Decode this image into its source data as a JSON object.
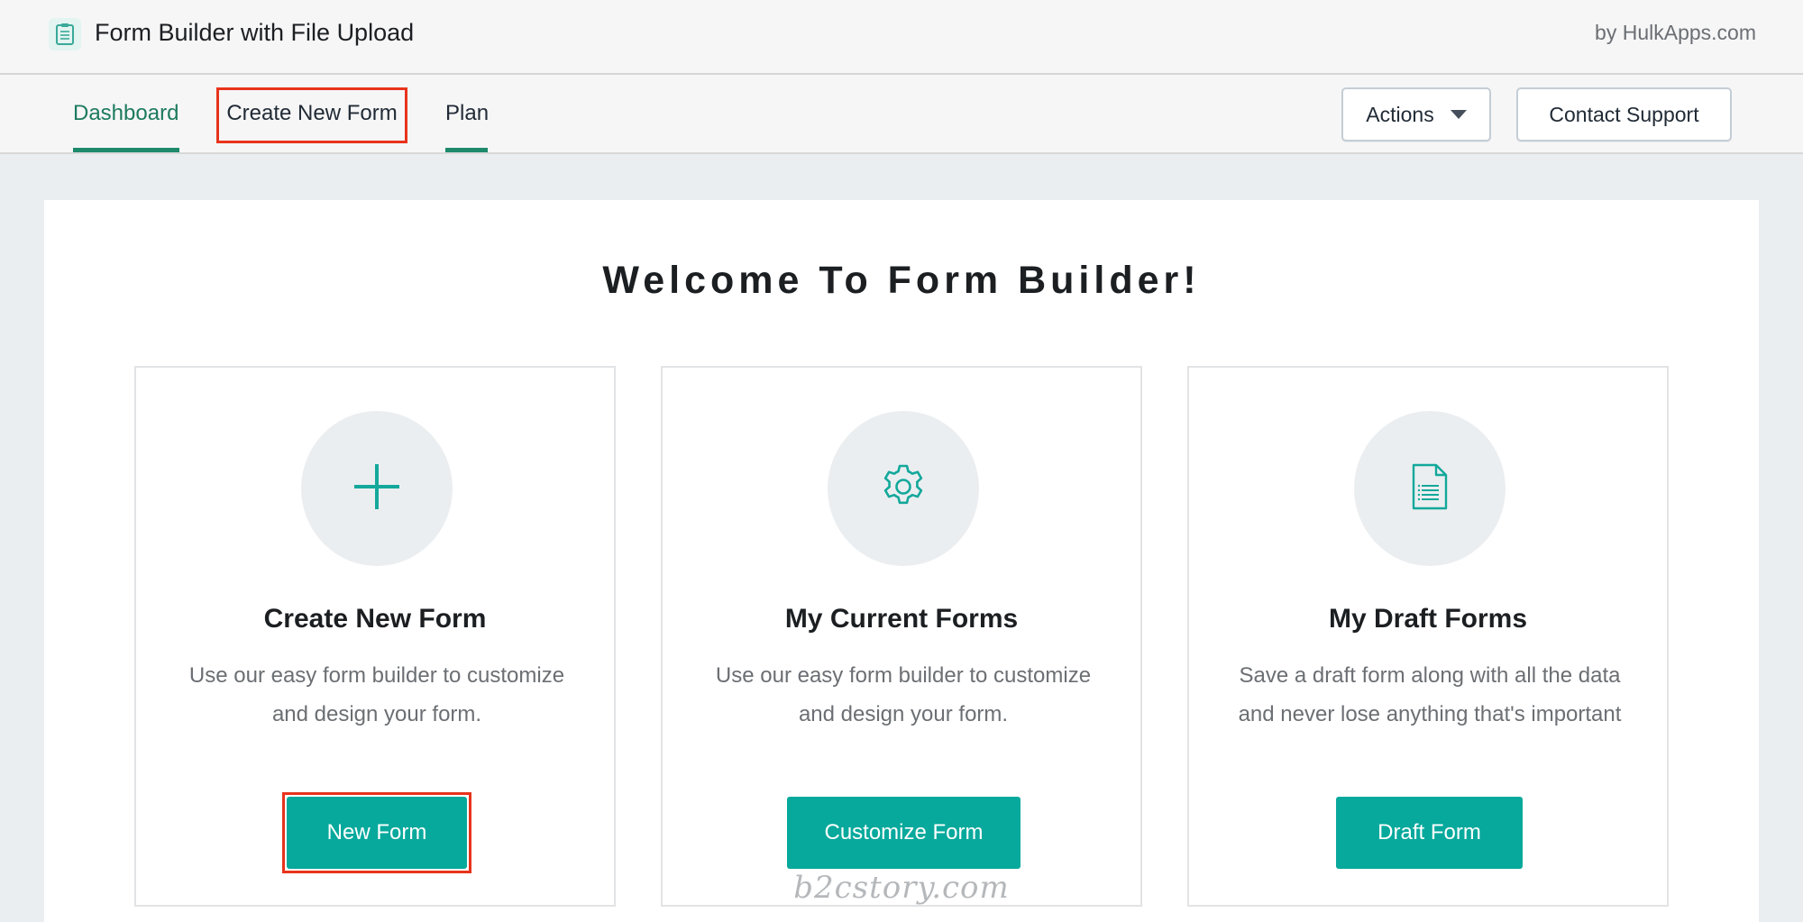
{
  "app": {
    "title": "Form Builder with File Upload",
    "byline": "by HulkApps.com",
    "icon": "clipboard-icon"
  },
  "nav": {
    "tabs": [
      {
        "label": "Dashboard",
        "active": true
      },
      {
        "label": "Create New Form",
        "active": false,
        "highlighted": true
      },
      {
        "label": "Plan",
        "active": false
      }
    ],
    "actions_label": "Actions",
    "support_label": "Contact Support"
  },
  "main": {
    "welcome": "Welcome To Form Builder!",
    "cards": [
      {
        "icon": "plus-icon",
        "title": "Create New Form",
        "description": "Use our easy form builder to customize and design your form.",
        "button": "New Form",
        "highlighted": true
      },
      {
        "icon": "gear-icon",
        "title": "My Current Forms",
        "description": "Use our easy form builder to customize and design your form.",
        "button": "Customize Form"
      },
      {
        "icon": "document-icon",
        "title": "My Draft Forms",
        "description": "Save a draft form along with all the data and never lose anything that's important",
        "button": "Draft Form"
      }
    ]
  },
  "watermark": "b2cstory.com",
  "colors": {
    "accent": "#07a99c",
    "tab_active": "#1d8a6c",
    "highlight": "#e8331c",
    "background": "#ebeef0"
  }
}
